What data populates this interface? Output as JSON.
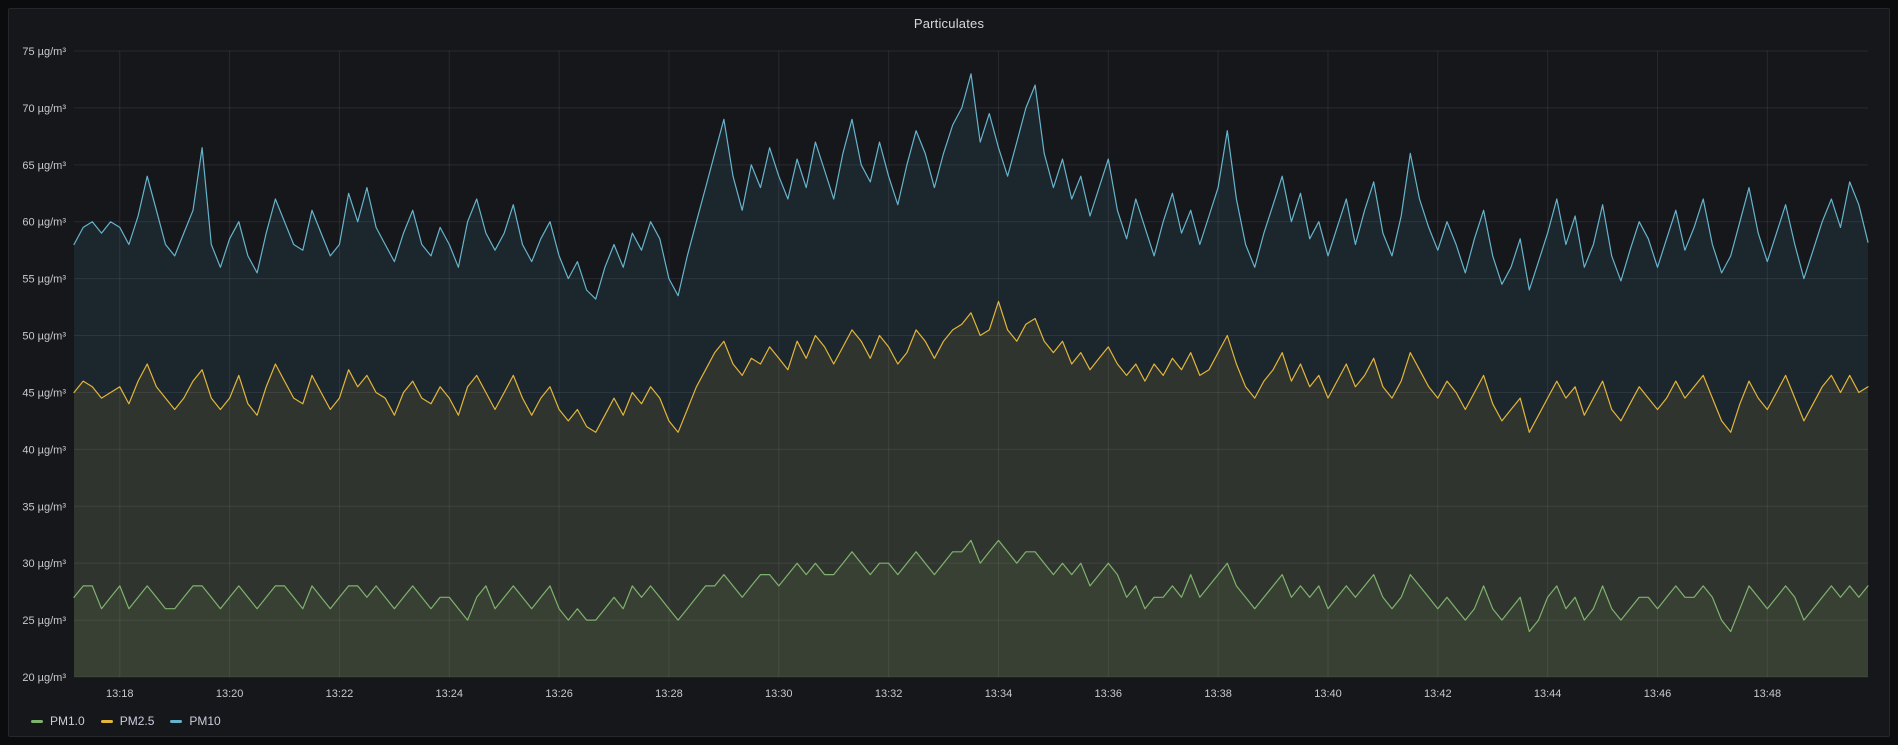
{
  "panel": {
    "title": "Particulates"
  },
  "chart_data": {
    "type": "line",
    "title": "Particulates",
    "unit": "µg/m³",
    "grid": true,
    "legend_position": "bottom-left",
    "background_color": "#15171b",
    "grid_color": "rgba(204,204,220,0.10)",
    "fill_opacity": 0.1,
    "x_axis": {
      "start_time": "13:17:10",
      "end_time": "13:49:50",
      "range_seconds": [
        0,
        1960
      ],
      "tick_interval": "2m",
      "ticks": [
        {
          "label": "13:18",
          "offset_s": 50
        },
        {
          "label": "13:20",
          "offset_s": 170
        },
        {
          "label": "13:22",
          "offset_s": 290
        },
        {
          "label": "13:24",
          "offset_s": 410
        },
        {
          "label": "13:26",
          "offset_s": 530
        },
        {
          "label": "13:28",
          "offset_s": 650
        },
        {
          "label": "13:30",
          "offset_s": 770
        },
        {
          "label": "13:32",
          "offset_s": 890
        },
        {
          "label": "13:34",
          "offset_s": 1010
        },
        {
          "label": "13:36",
          "offset_s": 1130
        },
        {
          "label": "13:38",
          "offset_s": 1250
        },
        {
          "label": "13:40",
          "offset_s": 1370
        },
        {
          "label": "13:42",
          "offset_s": 1490
        },
        {
          "label": "13:44",
          "offset_s": 1610
        },
        {
          "label": "13:46",
          "offset_s": 1730
        },
        {
          "label": "13:48",
          "offset_s": 1850
        }
      ]
    },
    "y_axis": {
      "min": 20,
      "max": 75,
      "tick_step": 5,
      "ticks": [
        {
          "value": 20,
          "label": "20 µg/m³"
        },
        {
          "value": 25,
          "label": "25 µg/m³"
        },
        {
          "value": 30,
          "label": "30 µg/m³"
        },
        {
          "value": 35,
          "label": "35 µg/m³"
        },
        {
          "value": 40,
          "label": "40 µg/m³"
        },
        {
          "value": 45,
          "label": "45 µg/m³"
        },
        {
          "value": 50,
          "label": "50 µg/m³"
        },
        {
          "value": 55,
          "label": "55 µg/m³"
        },
        {
          "value": 60,
          "label": "60 µg/m³"
        },
        {
          "value": 65,
          "label": "65 µg/m³"
        },
        {
          "value": 70,
          "label": "70 µg/m³"
        },
        {
          "value": 75,
          "label": "75 µg/m³"
        }
      ]
    },
    "sampling": {
      "x_start_offset_s": 0,
      "x_step_s": 10,
      "count": 197
    },
    "series": [
      {
        "name": "PM1.0",
        "color": "#7eb26d",
        "values": [
          27,
          28,
          28,
          26,
          27,
          28,
          26,
          27,
          28,
          27,
          26,
          26,
          27,
          28,
          28,
          27,
          26,
          27,
          28,
          27,
          26,
          27,
          28,
          28,
          27,
          26,
          28,
          27,
          26,
          27,
          28,
          28,
          27,
          28,
          27,
          26,
          27,
          28,
          27,
          26,
          27,
          27,
          26,
          25,
          27,
          28,
          26,
          27,
          28,
          27,
          26,
          27,
          28,
          26,
          25,
          26,
          25,
          25,
          26,
          27,
          26,
          28,
          27,
          28,
          27,
          26,
          25,
          26,
          27,
          28,
          28,
          29,
          28,
          27,
          28,
          29,
          29,
          28,
          29,
          30,
          29,
          30,
          29,
          29,
          30,
          31,
          30,
          29,
          30,
          30,
          29,
          30,
          31,
          30,
          29,
          30,
          31,
          31,
          32,
          30,
          31,
          32,
          31,
          30,
          31,
          31,
          30,
          29,
          30,
          29,
          30,
          28,
          29,
          30,
          29,
          27,
          28,
          26,
          27,
          27,
          28,
          27,
          29,
          27,
          28,
          29,
          30,
          28,
          27,
          26,
          27,
          28,
          29,
          27,
          28,
          27,
          28,
          26,
          27,
          28,
          27,
          28,
          29,
          27,
          26,
          27,
          29,
          28,
          27,
          26,
          27,
          26,
          25,
          26,
          28,
          26,
          25,
          26,
          27,
          24,
          25,
          27,
          28,
          26,
          27,
          25,
          26,
          28,
          26,
          25,
          26,
          27,
          27,
          26,
          27,
          28,
          27,
          27,
          28,
          27,
          25,
          24,
          26,
          28,
          27,
          26,
          27,
          28,
          27,
          25,
          26,
          27,
          28,
          27,
          28,
          27,
          28
        ]
      },
      {
        "name": "PM2.5",
        "color": "#e2b53b",
        "values": [
          45,
          46,
          45.5,
          44.5,
          45,
          45.5,
          44,
          46,
          47.5,
          45.5,
          44.5,
          43.5,
          44.5,
          46,
          47,
          44.5,
          43.5,
          44.5,
          46.5,
          44,
          43,
          45.5,
          47.5,
          46,
          44.5,
          44,
          46.5,
          45,
          43.5,
          44.5,
          47,
          45.5,
          46.5,
          45,
          44.5,
          43,
          45,
          46,
          44.5,
          44,
          45.5,
          44.5,
          43,
          45.5,
          46.5,
          45,
          43.5,
          45,
          46.5,
          44.5,
          43,
          44.5,
          45.5,
          43.5,
          42.5,
          43.5,
          42,
          41.5,
          43,
          44.5,
          43,
          45,
          44,
          45.5,
          44.5,
          42.5,
          41.5,
          43.5,
          45.5,
          47,
          48.5,
          49.5,
          47.5,
          46.5,
          48,
          47.5,
          49,
          48,
          47,
          49.5,
          48,
          50,
          49,
          47.5,
          49,
          50.5,
          49.5,
          48,
          50,
          49,
          47.5,
          48.5,
          50.5,
          49.5,
          48,
          49.5,
          50.5,
          51,
          52,
          50,
          50.5,
          53,
          50.5,
          49.5,
          51,
          51.5,
          49.5,
          48.5,
          49.5,
          47.5,
          48.5,
          47,
          48,
          49,
          47.5,
          46.5,
          47.5,
          46,
          47.5,
          46.5,
          48,
          47,
          48.5,
          46.5,
          47,
          48.5,
          50,
          47.5,
          45.5,
          44.5,
          46,
          47,
          48.5,
          46,
          47.5,
          45.5,
          46.5,
          44.5,
          46,
          47.5,
          45.5,
          46.5,
          48,
          45.5,
          44.5,
          46,
          48.5,
          47,
          45.5,
          44.5,
          46,
          45,
          43.5,
          45,
          46.5,
          44,
          42.5,
          43.5,
          44.5,
          41.5,
          43,
          44.5,
          46,
          44.5,
          45.5,
          43,
          44.5,
          46,
          43.5,
          42.5,
          44,
          45.5,
          44.5,
          43.5,
          44.5,
          46,
          44.5,
          45.5,
          46.5,
          44.5,
          42.5,
          41.5,
          44,
          46,
          44.5,
          43.5,
          45,
          46.5,
          44.5,
          42.5,
          44,
          45.5,
          46.5,
          45,
          46.5,
          45,
          45.5
        ]
      },
      {
        "name": "PM10",
        "color": "#66b4cc",
        "values": [
          58,
          59.5,
          60,
          59,
          60,
          59.5,
          58,
          60.5,
          64,
          61,
          58,
          57,
          59,
          61,
          66.5,
          58,
          56,
          58.5,
          60,
          57,
          55.5,
          59,
          62,
          60,
          58,
          57.5,
          61,
          59,
          57,
          58,
          62.5,
          60,
          63,
          59.5,
          58,
          56.5,
          59,
          61,
          58,
          57,
          59.5,
          58,
          56,
          60,
          62,
          59,
          57.5,
          59,
          61.5,
          58,
          56.5,
          58.5,
          60,
          57,
          55,
          56.5,
          54,
          53.2,
          56,
          58,
          56,
          59,
          57.5,
          60,
          58.5,
          55,
          53.5,
          57,
          60,
          63,
          66,
          69,
          64,
          61,
          65,
          63,
          66.5,
          64,
          62,
          65.5,
          63,
          67,
          64.5,
          62,
          66,
          69,
          65,
          63.5,
          67,
          64,
          61.5,
          65,
          68,
          66,
          63,
          66,
          68.5,
          70,
          73,
          67,
          69.5,
          66.5,
          64,
          67,
          70,
          72,
          66,
          63,
          65.5,
          62,
          64,
          60.5,
          63,
          65.5,
          61,
          58.5,
          62,
          59.5,
          57,
          60,
          62.5,
          59,
          61,
          58,
          60.5,
          63,
          68,
          62,
          58,
          56,
          59,
          61.5,
          64,
          60,
          62.5,
          58.5,
          60,
          57,
          59.5,
          62,
          58,
          61,
          63.5,
          59,
          57,
          60.5,
          66,
          62,
          59.5,
          57.5,
          60,
          58,
          55.5,
          58.5,
          61,
          57,
          54.5,
          56,
          58.5,
          54,
          56.5,
          59,
          62,
          58,
          60.5,
          56,
          58,
          61.5,
          57,
          54.8,
          57.5,
          60,
          58.5,
          56,
          58.5,
          61,
          57.5,
          59.5,
          62,
          58,
          55.5,
          57,
          60,
          63,
          59,
          56.5,
          59,
          61.5,
          58,
          55,
          57.5,
          60,
          62,
          59.5,
          63.5,
          61.5,
          58.2
        ]
      }
    ]
  }
}
